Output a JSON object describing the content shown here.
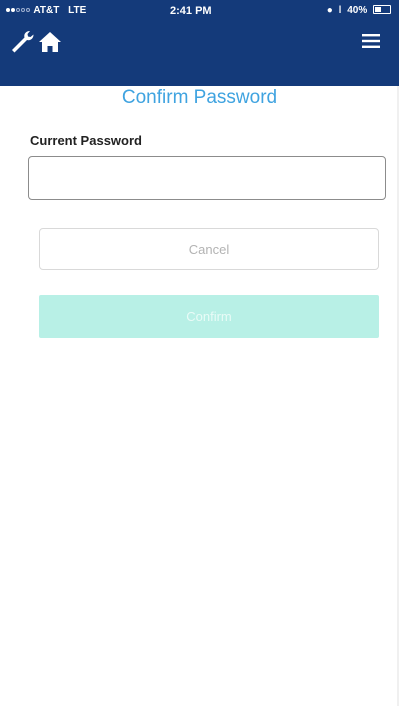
{
  "status_bar": {
    "carrier": "AT&T",
    "network": "LTE",
    "time": "2:41 PM",
    "battery": "40%",
    "battery_level": 0.4
  },
  "header": {
    "left_icons": [
      "wrench-icon",
      "home-icon"
    ],
    "right_icon": "hamburger-menu-icon",
    "background_color": "#143a7a"
  },
  "page": {
    "title": "Confirm Password",
    "title_color": "#3fa3e0"
  },
  "form": {
    "current_password_label": "Current Password",
    "current_password_value": "",
    "cancel_label": "Cancel",
    "confirm_label": "Confirm",
    "confirm_color": "#b8f0e6"
  }
}
